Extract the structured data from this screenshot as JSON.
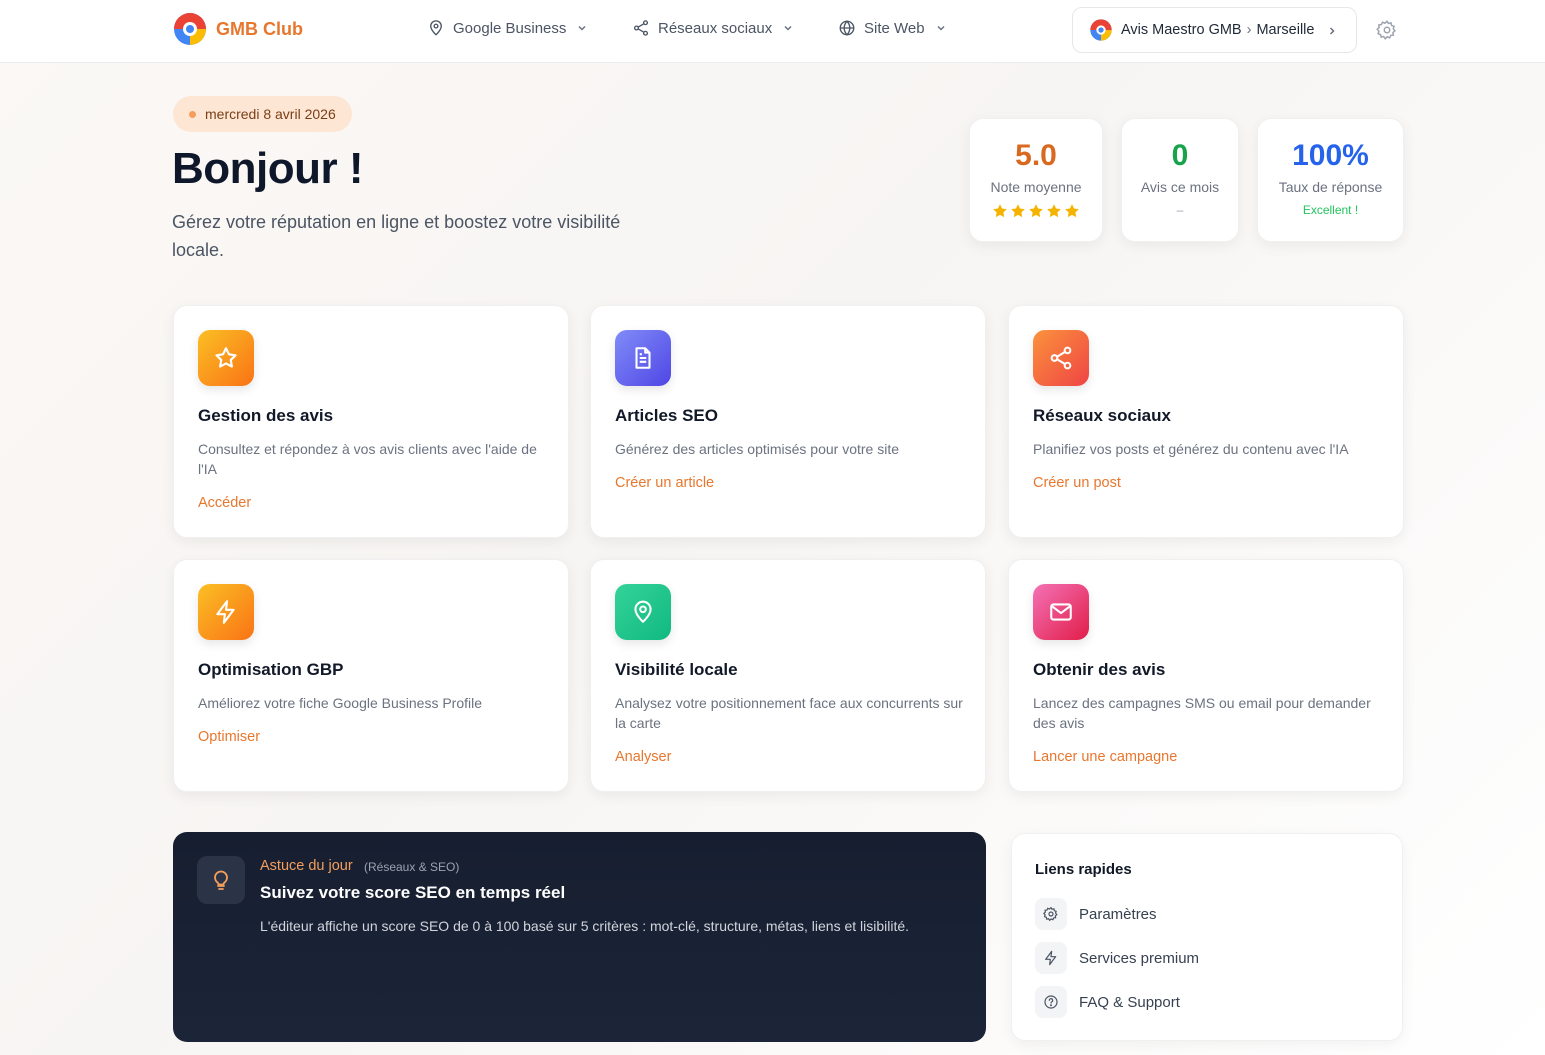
{
  "header": {
    "brand": "GMB Club",
    "nav": [
      {
        "label": "Google Business"
      },
      {
        "label": "Réseaux sociaux"
      },
      {
        "label": "Site Web"
      }
    ],
    "business": {
      "account": "Avis Maestro GMB",
      "separator": "›",
      "location": "Marseille"
    }
  },
  "hero": {
    "date": "mercredi 8 avril 2026",
    "title": "Bonjour !",
    "subtitle": "Gérez votre réputation en ligne et boostez votre visibilité locale."
  },
  "stats": [
    {
      "value": "5.0",
      "label": "Note moyenne",
      "stars": 5,
      "color": "#d9691f"
    },
    {
      "value": "0",
      "label": "Avis ce mois",
      "extra": "–",
      "color": "#16a34a"
    },
    {
      "value": "100%",
      "label": "Taux de réponse",
      "extra": "Excellent !",
      "color": "#2563eb",
      "extra_color": "#22c55e"
    }
  ],
  "cards": [
    {
      "title": "Gestion des avis",
      "desc": "Consultez et répondez à vos avis clients avec l'aide de l'IA",
      "link": "Accéder",
      "icon": "star-icon"
    },
    {
      "title": "Articles SEO",
      "desc": "Générez des articles optimisés pour votre site",
      "link": "Créer un article",
      "icon": "document-icon"
    },
    {
      "title": "Réseaux sociaux",
      "desc": "Planifiez vos posts et générez du contenu avec l'IA",
      "link": "Créer un post",
      "icon": "share-icon"
    },
    {
      "title": "Optimisation GBP",
      "desc": "Améliorez votre fiche Google Business Profile",
      "link": "Optimiser",
      "icon": "bolt-icon"
    },
    {
      "title": "Visibilité locale",
      "desc": "Analysez votre positionnement face aux concurrents sur la carte",
      "link": "Analyser",
      "icon": "map-pin-icon"
    },
    {
      "title": "Obtenir des avis",
      "desc": "Lancez des campagnes SMS ou email pour demander des avis",
      "link": "Lancer une campagne",
      "icon": "mail-icon"
    }
  ],
  "tip": {
    "label": "Astuce du jour",
    "category": "(Réseaux & SEO)",
    "title": "Suivez votre score SEO en temps réel",
    "body": "L'éditeur affiche un score SEO de 0 à 100 basé sur 5 critères : mot-clé, structure, métas, liens et lisibilité."
  },
  "quick_links": {
    "title": "Liens rapides",
    "items": [
      {
        "label": "Paramètres",
        "icon": "gear-icon"
      },
      {
        "label": "Services premium",
        "icon": "bolt-icon"
      },
      {
        "label": "FAQ & Support",
        "icon": "help-icon"
      }
    ]
  },
  "colors": {
    "accent": "#e8772e"
  }
}
